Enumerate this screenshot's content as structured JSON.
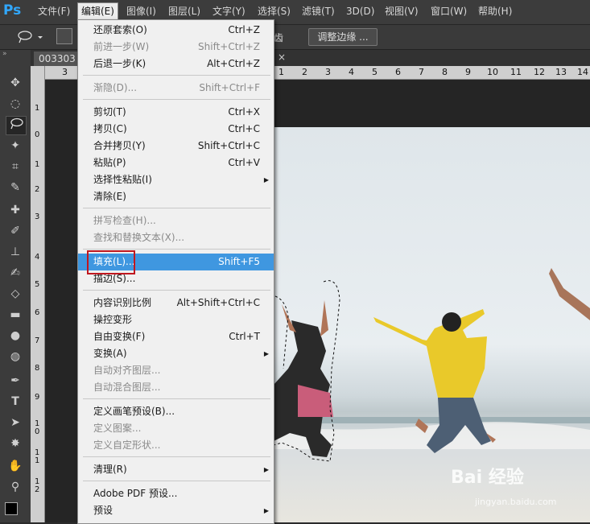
{
  "app": {
    "logo": "Ps",
    "accent": "#31a8ff"
  },
  "menubar": {
    "items": [
      {
        "label": "文件(F)"
      },
      {
        "label": "编辑(E)"
      },
      {
        "label": "图像(I)"
      },
      {
        "label": "图层(L)"
      },
      {
        "label": "文字(Y)"
      },
      {
        "label": "选择(S)"
      },
      {
        "label": "滤镜(T)"
      },
      {
        "label": "3D(D)"
      },
      {
        "label": "视图(V)"
      },
      {
        "label": "窗口(W)"
      },
      {
        "label": "帮助(H)"
      }
    ]
  },
  "options": {
    "partial_text": "齿",
    "refine_edge_label": "调整边缘 ..."
  },
  "document": {
    "tab_label": "003303",
    "close_glyph": "×"
  },
  "ruler_h": [
    "3",
    "1",
    "2",
    "3",
    "4",
    "5",
    "6",
    "7",
    "8",
    "9",
    "10",
    "11",
    "12",
    "13",
    "14"
  ],
  "ruler_v": [
    "1",
    "0",
    "1",
    "2",
    "3",
    "4",
    "5",
    "6",
    "7",
    "8",
    "9",
    "1\n0",
    "1\n1",
    "1\n2"
  ],
  "edit_menu": {
    "items": [
      {
        "label": "还原套索(O)",
        "shortcut": "Ctrl+Z"
      },
      {
        "label": "前进一步(W)",
        "shortcut": "Shift+Ctrl+Z"
      },
      {
        "label": "后退一步(K)",
        "shortcut": "Alt+Ctrl+Z"
      },
      {
        "label": "渐隐(D)...",
        "shortcut": "Shift+Ctrl+F"
      },
      {
        "label": "剪切(T)",
        "shortcut": "Ctrl+X"
      },
      {
        "label": "拷贝(C)",
        "shortcut": "Ctrl+C"
      },
      {
        "label": "合并拷贝(Y)",
        "shortcut": "Shift+Ctrl+C"
      },
      {
        "label": "粘贴(P)",
        "shortcut": "Ctrl+V"
      },
      {
        "label": "选择性粘贴(I)",
        "shortcut": ""
      },
      {
        "label": "清除(E)",
        "shortcut": ""
      },
      {
        "label": "拼写检查(H)...",
        "shortcut": ""
      },
      {
        "label": "查找和替换文本(X)...",
        "shortcut": ""
      },
      {
        "label": "填充(L)...",
        "shortcut": "Shift+F5"
      },
      {
        "label": "描边(S)...",
        "shortcut": ""
      },
      {
        "label": "内容识别比例",
        "shortcut": "Alt+Shift+Ctrl+C"
      },
      {
        "label": "操控变形",
        "shortcut": ""
      },
      {
        "label": "自由变换(F)",
        "shortcut": "Ctrl+T"
      },
      {
        "label": "变换(A)",
        "shortcut": ""
      },
      {
        "label": "自动对齐图层...",
        "shortcut": ""
      },
      {
        "label": "自动混合图层...",
        "shortcut": ""
      },
      {
        "label": "定义画笔预设(B)...",
        "shortcut": ""
      },
      {
        "label": "定义图案...",
        "shortcut": ""
      },
      {
        "label": "定义自定形状...",
        "shortcut": ""
      },
      {
        "label": "清理(R)",
        "shortcut": ""
      },
      {
        "label": "Adobe PDF 预设...",
        "shortcut": ""
      },
      {
        "label": "预设",
        "shortcut": ""
      }
    ],
    "submenu_arrow": "▶"
  },
  "watermark": {
    "text": "Bai 经验",
    "sub": "jingyan.baidu.com"
  },
  "colors": {
    "highlight": "#3f97e0",
    "redbox": "#c0171f"
  }
}
